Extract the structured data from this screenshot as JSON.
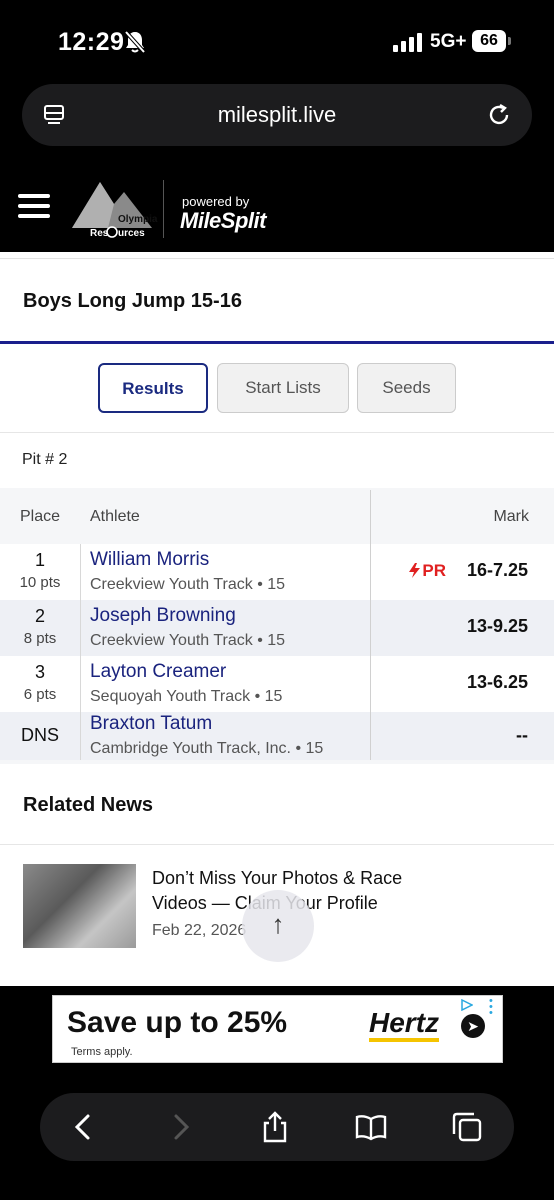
{
  "status_bar": {
    "time": "12:29",
    "network": "5G+",
    "battery": "66"
  },
  "browser": {
    "url": "milesplit.live"
  },
  "header": {
    "powered_by": "powered by",
    "brand": "MileSplit"
  },
  "event": {
    "title": "Boys Long Jump 15-16"
  },
  "tabs": [
    {
      "label": "Results",
      "active": true
    },
    {
      "label": "Start Lists",
      "active": false
    },
    {
      "label": "Seeds",
      "active": false
    }
  ],
  "pit": "Pit # 2",
  "table": {
    "headers": {
      "place": "Place",
      "athlete": "Athlete",
      "mark": "Mark"
    },
    "rows": [
      {
        "place": "1",
        "pts": "10 pts",
        "athlete": "William Morris",
        "team": "Creekview Youth Track • 15",
        "pr": "PR",
        "mark": "16-7.25"
      },
      {
        "place": "2",
        "pts": "8 pts",
        "athlete": "Joseph Browning",
        "team": "Creekview Youth Track • 15",
        "pr": "",
        "mark": "13-9.25"
      },
      {
        "place": "3",
        "pts": "6 pts",
        "athlete": "Layton Creamer",
        "team": "Sequoyah Youth Track • 15",
        "pr": "",
        "mark": "13-6.25"
      },
      {
        "place": "DNS",
        "pts": "",
        "athlete": "Braxton Tatum",
        "team": "Cambridge Youth Track, Inc. • 15",
        "pr": "",
        "mark": "--"
      }
    ]
  },
  "related": {
    "title": "Related News",
    "item": {
      "headline": "Don’t Miss Your Photos & Race Videos — Claim Your Profile",
      "date": "Feb 22, 2026"
    }
  },
  "ad": {
    "headline": "Save up to 25%",
    "terms": "Terms apply.",
    "brand": "Hertz"
  },
  "colors": {
    "accent": "#1a237e",
    "rule": "#1a1f8c",
    "pr": "#e02020"
  }
}
